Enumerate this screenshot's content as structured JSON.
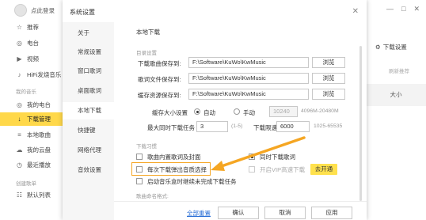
{
  "app": {
    "user_label": "点此登录",
    "sidebar": [
      {
        "label": "推荐",
        "icon": "star-icon",
        "glyph": "☆"
      },
      {
        "label": "电台",
        "icon": "radio-icon",
        "glyph": "◎"
      },
      {
        "label": "视频",
        "icon": "video-icon",
        "glyph": "▶"
      },
      {
        "label": "HiFi发烧音乐",
        "icon": "hifi-icon",
        "glyph": "♪"
      }
    ],
    "section_mine": "我的音乐",
    "sidebar_mine": [
      {
        "label": "我的电台",
        "icon": "radio-icon",
        "glyph": "◎"
      },
      {
        "label": "下载管理",
        "icon": "download-icon",
        "glyph": "↓",
        "active": true
      },
      {
        "label": "本地歌曲",
        "icon": "local-music-icon",
        "glyph": "≡"
      },
      {
        "label": "我的云盘",
        "icon": "cloud-icon",
        "glyph": "☁"
      },
      {
        "label": "最近播放",
        "icon": "history-icon",
        "glyph": "◷"
      }
    ],
    "section_created": "创建歌单",
    "default_list": {
      "label": "默认列表",
      "icon": "playlist-icon",
      "glyph": "☷"
    },
    "right": {
      "download_settings": "下载设置",
      "link_label": "刷新推荐",
      "size_label": "大小"
    },
    "window_controls": [
      "—",
      "□",
      "✕"
    ]
  },
  "dialog": {
    "title": "系统设置",
    "close": "✕",
    "nav": [
      "关于",
      "常规设置",
      "窗口歌词",
      "桌面歌词",
      "本地下载",
      "快捷键",
      "网络代理",
      "音效设置"
    ],
    "active_nav": "本地下载",
    "section_title": "本地下载",
    "dir_title": "目录设置",
    "dirs": [
      {
        "label": "下载歌曲保存到:",
        "value": "F:\\Software\\KuWo\\KwMusic",
        "button": "浏览"
      },
      {
        "label": "歌词文件保存到:",
        "value": "F:\\Software\\KuWo\\KwMusic",
        "button": "浏览"
      },
      {
        "label": "缓存资源保存到:",
        "value": "F:\\Software\\KuWo\\KwMusic",
        "button": "浏览"
      }
    ],
    "cache": {
      "label": "缓存大小设置",
      "auto": "自动",
      "manual": "手动",
      "value": "10240",
      "range": "4096M-20480M"
    },
    "tasks": {
      "label": "最大同时下载任务",
      "value": "3",
      "range": "(1-5)",
      "speed_label": "下载限速",
      "speed_value": "6000",
      "speed_range": "1025-65535"
    },
    "habit_title": "下载习惯",
    "habits": {
      "song_lyrics": "歌曲内置歌词及封面",
      "sync_lyrics": "同时下载歌词",
      "quality_popup": "每次下载弹出音质选择",
      "vip_channel": "开启VIP高速下载",
      "vip_button": "去开通",
      "resume": "启动音乐盒时继续未完成下载任务"
    },
    "naming_title": "歌曲命名格式:",
    "footer": {
      "reset": "全部重置",
      "ok": "确认",
      "cancel": "取消",
      "apply": "应用"
    }
  },
  "annotation": {
    "arrow_color": "#f5a623"
  }
}
